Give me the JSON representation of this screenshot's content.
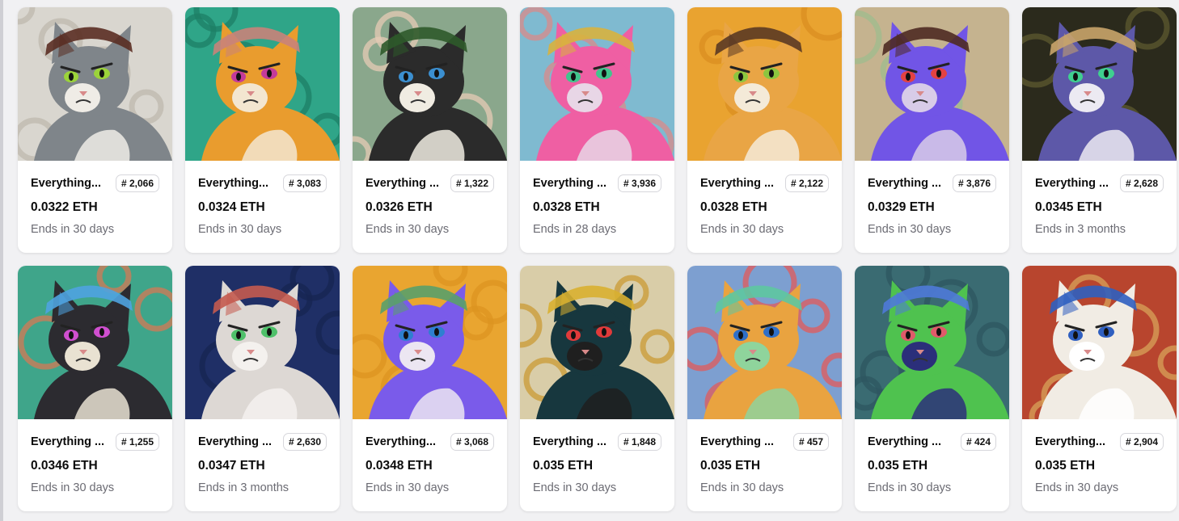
{
  "cards": [
    {
      "name": "Everything...",
      "token": "# 2,066",
      "price": "0.0322 ETH",
      "ends": "Ends in 30 days",
      "bg": "#d9d6cf",
      "bg2": "#bdb8ae",
      "fur": "#7f858a",
      "fur2": "#efece6",
      "accent": "#5a2e22",
      "eye": "#9bd33a"
    },
    {
      "name": "Everything...",
      "token": "# 3,083",
      "price": "0.0324 ETH",
      "ends": "Ends in 30 days",
      "bg": "#2fa588",
      "bg2": "#1e7f66",
      "fur": "#e99c2e",
      "fur2": "#f3e6d0",
      "accent": "#c9837a",
      "eye": "#c43a9a"
    },
    {
      "name": "Everything ...",
      "token": "# 1,322",
      "price": "0.0326 ETH",
      "ends": "Ends in 30 days",
      "bg": "#8aa78c",
      "bg2": "#e5cbb6",
      "fur": "#2b2b2b",
      "fur2": "#f0ece2",
      "accent": "#2e5a2a",
      "eye": "#3b8fd0"
    },
    {
      "name": "Everything ...",
      "token": "# 3,936",
      "price": "0.0328 ETH",
      "ends": "Ends in 28 days",
      "bg": "#7fbad0",
      "bg2": "#d98a8a",
      "fur": "#ef5fa3",
      "fur2": "#e8d6e6",
      "accent": "#d8b23e",
      "eye": "#41c58d"
    },
    {
      "name": "Everything ...",
      "token": "# 2,122",
      "price": "0.0328 ETH",
      "ends": "Ends in 30 days",
      "bg": "#e9a330",
      "bg2": "#d98d20",
      "fur": "#e9a545",
      "fur2": "#f4ead8",
      "accent": "#5b3a24",
      "eye": "#8cc63f"
    },
    {
      "name": "Everything ...",
      "token": "# 3,876",
      "price": "0.0329 ETH",
      "ends": "Ends in 30 days",
      "bg": "#c5b38f",
      "bg2": "#9ebc8e",
      "fur": "#7155e6",
      "fur2": "#d8cce8",
      "accent": "#4e2a22",
      "eye": "#e34242"
    },
    {
      "name": "Everything ...",
      "token": "# 2,628",
      "price": "0.0345 ETH",
      "ends": "Ends in 3 months",
      "bg": "#2b2a1c",
      "bg2": "#5d5a2f",
      "fur": "#5d58a8",
      "fur2": "#eceaf2",
      "accent": "#c9a46a",
      "eye": "#3fd08f"
    },
    {
      "name": "Everything ...",
      "token": "# 1,255",
      "price": "0.0346 ETH",
      "ends": "Ends in 30 days",
      "bg": "#3fa58a",
      "bg2": "#d67a54",
      "fur": "#2c2b30",
      "fur2": "#e9e2d2",
      "accent": "#4fa3e0",
      "eye": "#d04fd0"
    },
    {
      "name": "Everything ...",
      "token": "# 2,630",
      "price": "0.0347 ETH",
      "ends": "Ends in 3 months",
      "bg": "#1f2f66",
      "bg2": "#172552",
      "fur": "#ddd8d4",
      "fur2": "#f4f1ee",
      "accent": "#c45b4f",
      "eye": "#4fc06a"
    },
    {
      "name": "Everything...",
      "token": "# 3,068",
      "price": "0.0348 ETH",
      "ends": "Ends in 30 days",
      "bg": "#e9a530",
      "bg2": "#dc9420",
      "fur": "#7a5bea",
      "fur2": "#ece6f2",
      "accent": "#5aa06a",
      "eye": "#2e7fd0"
    },
    {
      "name": "Everything ...",
      "token": "# 1,848",
      "price": "0.035 ETH",
      "ends": "Ends in 30 days",
      "bg": "#d9cda8",
      "bg2": "#c99a34",
      "fur": "#17373e",
      "fur2": "#1f1f1f",
      "accent": "#d8b030",
      "eye": "#e03a3a"
    },
    {
      "name": "Everything ...",
      "token": "# 457",
      "price": "0.035 ETH",
      "ends": "Ends in 30 days",
      "bg": "#7d9fd0",
      "bg2": "#e35a5a",
      "fur": "#e9a340",
      "fur2": "#8fd49c",
      "accent": "#5ec6a0",
      "eye": "#2f6fc8"
    },
    {
      "name": "Everything ...",
      "token": "# 424",
      "price": "0.035 ETH",
      "ends": "Ends in 30 days",
      "bg": "#3a6b72",
      "bg2": "#2d5660",
      "fur": "#4fc24f",
      "fur2": "#2b2f7a",
      "accent": "#4f7ad8",
      "eye": "#e05a6a"
    },
    {
      "name": "Everything...",
      "token": "# 2,904",
      "price": "0.035 ETH",
      "ends": "Ends in 30 days",
      "bg": "#b8452e",
      "bg2": "#d8a35a",
      "fur": "#f1ece4",
      "fur2": "#ffffff",
      "accent": "#2f5fc0",
      "eye": "#2f5fc0"
    }
  ]
}
